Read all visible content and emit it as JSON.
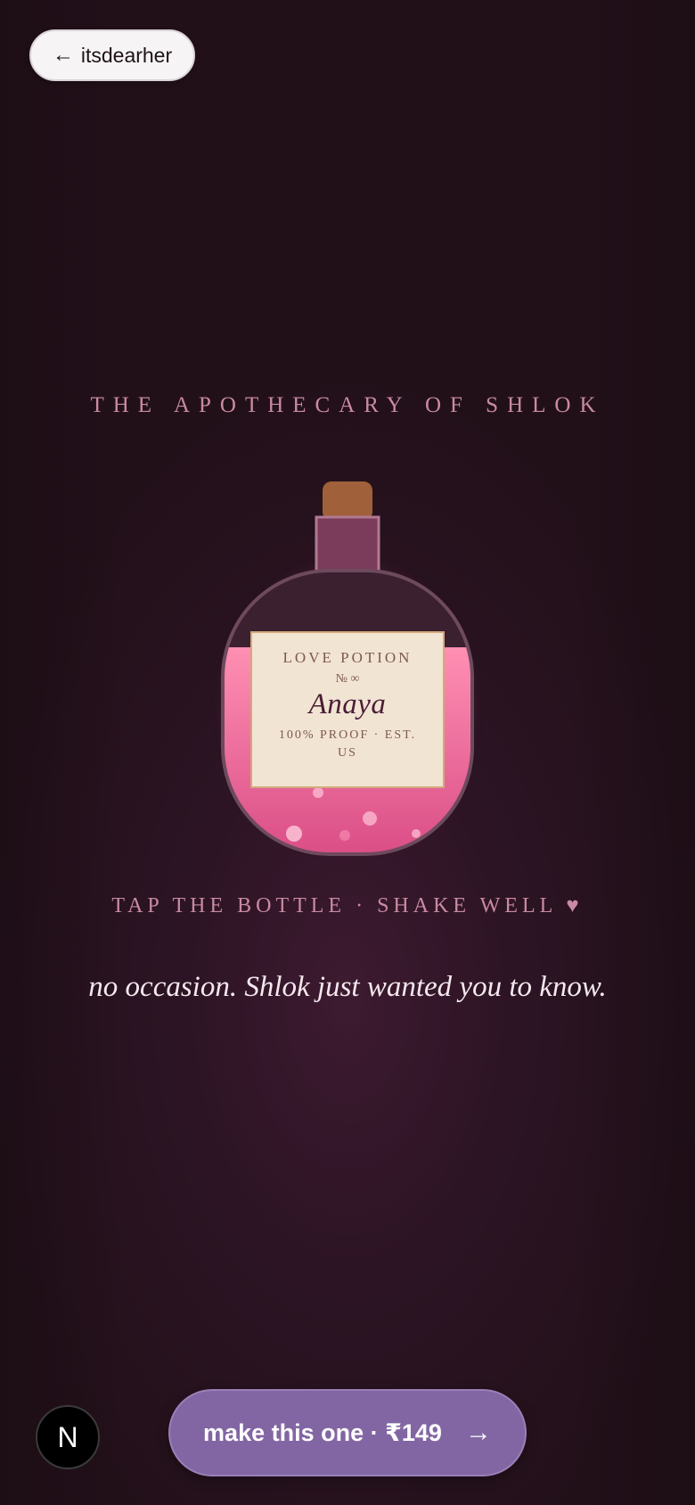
{
  "header": {
    "back_arrow": "←",
    "back_label": "itsdearher"
  },
  "eyebrow": "THE APOTHECARY OF SHLOK",
  "bottle": {
    "label_title": "LOVE POTION",
    "label_number": "№ ∞",
    "label_name": "Anaya",
    "label_foot": "100% PROOF · EST. US",
    "colors": {
      "liquid": "#ff7fa8",
      "cork": "#a0603a",
      "label": "#f2e4d3"
    }
  },
  "instructions": "TAP THE BOTTLE · SHAKE WELL ♥",
  "message": "no occasion. Shlok just wanted you to know.",
  "footer": {
    "badge_letter": "N",
    "cta_label": "make this one · ₹149",
    "cta_arrow": "→"
  },
  "colors": {
    "background": "#2c1424",
    "accent": "#8266a3",
    "muted_text": "#c98aa2"
  }
}
